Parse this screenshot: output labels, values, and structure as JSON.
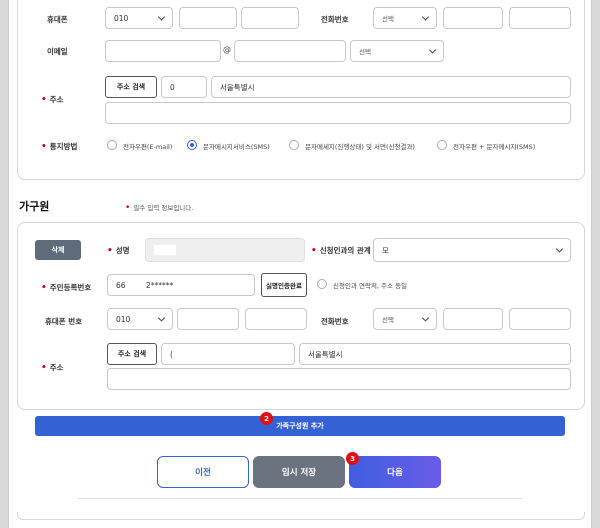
{
  "applicant": {
    "mobile_label": "휴대폰",
    "mobile_prefix": "010",
    "phone_label": "전화번호",
    "phone_select": "선택",
    "email_label": "이메일",
    "email_at": "@",
    "email_domain_select": "선택",
    "address_label": "주소",
    "address_search_button": "주소 검색",
    "address_zip": "0",
    "address_line1": "서울특별시",
    "notify_label": "통지방법",
    "notify_options": [
      "전자우편(E-mail)",
      "문자메시지서비스(SMS)",
      "문자메세지(진행상태) 및 서면(신청결과)",
      "전자우편 + 문자메시지(SMS)"
    ],
    "notify_selected_index": 1
  },
  "household": {
    "section_title": "가구원",
    "required_note": "필수 입력 정보입니다.",
    "delete_button": "삭제",
    "name_label": "성명",
    "relation_label": "신청인과의 관계",
    "relation_value": "모",
    "rrn_label": "주민등록번호",
    "rrn_front": "66",
    "rrn_back": "2******",
    "verified_button": "실명인증완료",
    "consent_text": "신청인과 연락처, 주소 동일",
    "mobile_label": "휴대폰 번호",
    "mobile_prefix": "010",
    "phone_label": "전화번호",
    "phone_select": "선택",
    "address_label": "주소",
    "address_search_button": "주소 검색",
    "address_zip": "(",
    "address_line1": "서울특별시"
  },
  "add_member_button": "가족구성원 추가",
  "nav": {
    "prev": "이전",
    "save": "임시 저장",
    "next": "다음"
  },
  "badges": {
    "add": "2",
    "next": "3"
  },
  "colors": {
    "primary": "#3461d4",
    "save_gray": "#6b7280",
    "required": "#d0021b"
  }
}
